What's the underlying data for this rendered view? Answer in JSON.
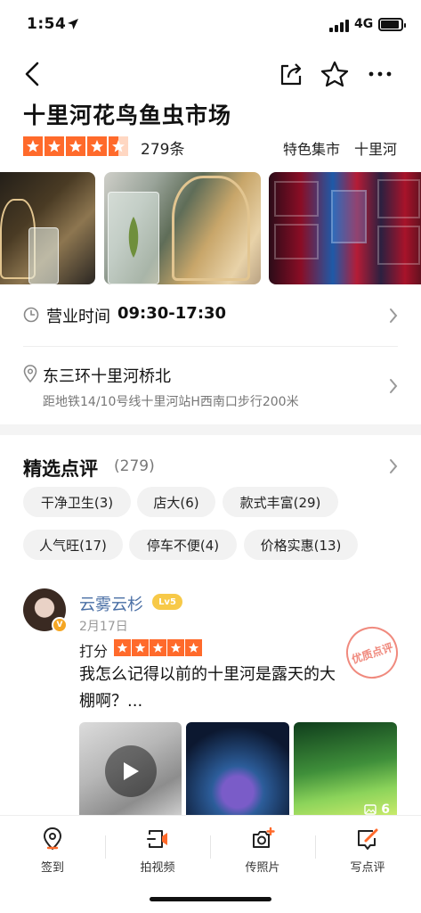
{
  "status_bar": {
    "time": "1:54",
    "network": "4G"
  },
  "nav": {
    "back_icon": "back-arrow-icon",
    "share_icon": "share-icon",
    "star_icon": "star-outline-icon",
    "more_icon": "more-icon"
  },
  "place": {
    "title": "十里河花鸟鱼虫市场",
    "rating": 4.5,
    "review_count": "279条",
    "category": "特色集市",
    "area": "十里河"
  },
  "info": {
    "hours_label": "营业时间",
    "hours_value": "09:30-17:30",
    "address": "东三环十里河桥北",
    "directions": "距地铁14/10号线十里河站H西南口步行200米"
  },
  "reviews": {
    "title": "精选点评",
    "count": "(279)",
    "tags": [
      "干净卫生(3)",
      "店大(6)",
      "款式丰富(29)",
      "人气旺(17)",
      "停车不便(4)",
      "价格实惠(13)"
    ],
    "items": [
      {
        "user": "云雾云杉",
        "level": "Lv5",
        "vip_badge": "V",
        "date": "2月17日",
        "score_label": "打分",
        "score": 5,
        "stamp": "优质点评",
        "text": "我怎么记得以前的十里河是露天的大棚啊？...",
        "photo_count": "6"
      }
    ]
  },
  "bottom_bar": {
    "tabs": [
      {
        "label": "签到",
        "icon": "location-pin-icon",
        "accent": "#ff6a2b"
      },
      {
        "label": "拍视频",
        "icon": "video-camera-icon",
        "accent": "#ff6a2b"
      },
      {
        "label": "传照片",
        "icon": "photo-camera-icon",
        "accent": "#ff6a2b"
      },
      {
        "label": "写点评",
        "icon": "write-review-icon",
        "accent": "#ff6a2b"
      }
    ]
  },
  "colors": {
    "accent": "#ff6a2b",
    "link": "#4a6fa5",
    "muted": "#777777"
  }
}
